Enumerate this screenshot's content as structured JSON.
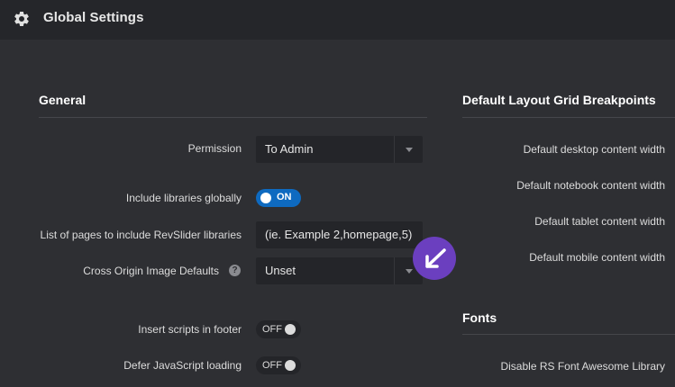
{
  "header": {
    "title": "Global Settings",
    "icon": "gear-icon"
  },
  "general": {
    "title": "General",
    "permission": {
      "label": "Permission",
      "value": "To Admin"
    },
    "include_libraries": {
      "label": "Include libraries globally",
      "state": "ON"
    },
    "pages_list": {
      "label": "List of pages to include RevSlider libraries",
      "placeholder": "(ie. Example 2,homepage,5)"
    },
    "cross_origin": {
      "label": "Cross Origin Image Defaults",
      "value": "Unset",
      "help": "?"
    },
    "footer_scripts": {
      "label": "Insert scripts in footer",
      "state": "OFF"
    },
    "defer_js": {
      "label": "Defer JavaScript loading",
      "state": "OFF"
    }
  },
  "breakpoints": {
    "title": "Default Layout Grid Breakpoints",
    "items": [
      "Default desktop content width",
      "Default notebook content width",
      "Default tablet content width",
      "Default mobile content width"
    ]
  },
  "fonts": {
    "title": "Fonts",
    "disable_font_awesome": "Disable RS Font Awesome Library"
  },
  "colors": {
    "background": "#2e2f33",
    "header": "#25262a",
    "accent": "#0e6ac0",
    "badge": "#6b3fbf"
  }
}
